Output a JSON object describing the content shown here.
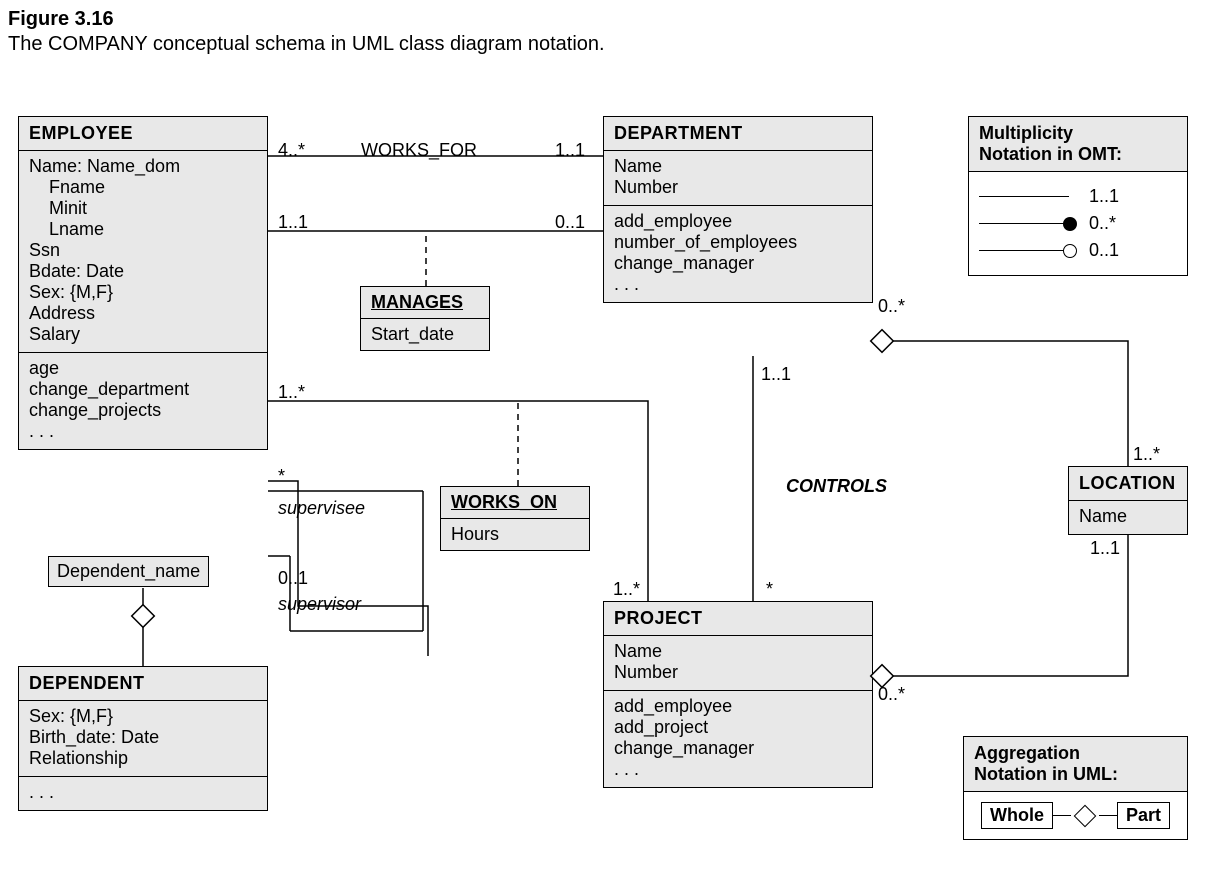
{
  "figure": {
    "title": "Figure 3.16",
    "caption": "The COMPANY conceptual schema in UML class diagram notation."
  },
  "classes": {
    "employee": {
      "name": "EMPLOYEE",
      "attrs": "Name: Name_dom\n    Fname\n    Minit\n    Lname\nSsn\nBdate: Date\nSex: {M,F}\nAddress\nSalary",
      "ops": "age\nchange_department\nchange_projects\n. . ."
    },
    "department": {
      "name": "DEPARTMENT",
      "attrs": "Name\nNumber",
      "ops": "add_employee\nnumber_of_employees\nchange_manager\n. . ."
    },
    "project": {
      "name": "PROJECT",
      "attrs": "Name\nNumber",
      "ops": "add_employee\nadd_project\nchange_manager\n. . ."
    },
    "location": {
      "name": "LOCATION",
      "attr": "Name"
    },
    "dependent": {
      "name": "DEPENDENT",
      "attrs": "Sex: {M,F}\nBirth_date: Date\nRelationship",
      "ops": ". . ."
    }
  },
  "assoc_classes": {
    "manages": {
      "name": "MANAGES",
      "attr": "Start_date"
    },
    "works_on": {
      "name": "WORKS_ON",
      "attr": "Hours"
    }
  },
  "qualifier": {
    "dependent_name": "Dependent_name"
  },
  "labels": {
    "works_for": "WORKS_FOR",
    "controls": "CONTROLS",
    "supervisee": "supervisee",
    "supervisor": "supervisor",
    "m_4s": "4..*",
    "m_1_1": "1..1",
    "m_0_1": "0..1",
    "m_1s": "1..*",
    "m_star": "*",
    "m_0s": "0..*"
  },
  "legends": {
    "omt": {
      "title": "Multiplicity\nNotation in OMT:",
      "r1": "1..1",
      "r2": "0..*",
      "r3": "0..1"
    },
    "agg": {
      "title": "Aggregation\nNotation in UML:",
      "whole": "Whole",
      "part": "Part"
    }
  }
}
